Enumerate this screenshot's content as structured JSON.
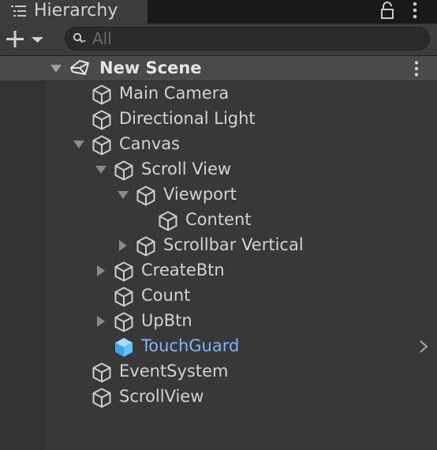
{
  "window": {
    "tab_title": "Hierarchy",
    "tab_icon": "hierarchy-list-icon",
    "lock_icon": "lock-icon",
    "menu_icon": "kebab-menu-icon"
  },
  "toolbar": {
    "add_button_icon": "plus-dropdown-icon",
    "search_icon": "search-icon",
    "search_placeholder": "All",
    "search_value": ""
  },
  "scene": {
    "name": "New Scene",
    "icon": "unity-scene-icon",
    "expanded": true,
    "menu_icon": "kebab-menu-icon"
  },
  "items": [
    {
      "label": "Main Camera",
      "depth": 0,
      "foldout": "none",
      "icon": "gameobject-cube-icon"
    },
    {
      "label": "Directional Light",
      "depth": 0,
      "foldout": "none",
      "icon": "gameobject-cube-icon"
    },
    {
      "label": "Canvas",
      "depth": 0,
      "foldout": "expanded",
      "icon": "gameobject-cube-icon"
    },
    {
      "label": "Scroll View",
      "depth": 1,
      "foldout": "expanded",
      "icon": "gameobject-cube-icon"
    },
    {
      "label": "Viewport",
      "depth": 2,
      "foldout": "expanded",
      "icon": "gameobject-cube-icon"
    },
    {
      "label": "Content",
      "depth": 3,
      "foldout": "none",
      "icon": "gameobject-cube-icon"
    },
    {
      "label": "Scrollbar Vertical",
      "depth": 2,
      "foldout": "collapsed",
      "icon": "gameobject-cube-icon"
    },
    {
      "label": "CreateBtn",
      "depth": 1,
      "foldout": "collapsed",
      "icon": "gameobject-cube-icon"
    },
    {
      "label": "Count",
      "depth": 1,
      "foldout": "none",
      "icon": "gameobject-cube-icon"
    },
    {
      "label": "UpBtn",
      "depth": 1,
      "foldout": "collapsed",
      "icon": "gameobject-cube-icon"
    },
    {
      "label": "TouchGuard",
      "depth": 1,
      "foldout": "none",
      "icon": "prefab-cube-icon",
      "prefab": true,
      "has_arrow": true
    },
    {
      "label": "EventSystem",
      "depth": 0,
      "foldout": "none",
      "icon": "gameobject-cube-icon"
    },
    {
      "label": "ScrollView",
      "depth": 0,
      "foldout": "none",
      "icon": "gameobject-cube-icon"
    }
  ],
  "colors": {
    "panel_bg": "#383838",
    "gutter_bg": "#333333",
    "tabbar_bg": "#191919",
    "scene_row_bg": "#4a4a4a",
    "text": "#d2d2d2",
    "prefab_text": "#7fb5ff",
    "prefab_icon": "#4ab7f2"
  }
}
